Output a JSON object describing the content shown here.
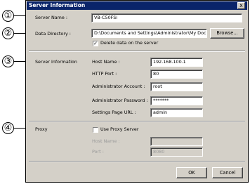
{
  "dialog": {
    "title": "Server Information",
    "close_glyph": "x"
  },
  "callouts": [
    "①",
    "②",
    "③",
    "④"
  ],
  "server": {
    "name_label": "Server Name :",
    "name_value": "VB-C50FSi",
    "dir_label": "Data Directory :",
    "dir_value": "D:\\Documents and Settings\\Administrator\\My Docume",
    "browse_label": "Browse...",
    "delete_label": "Delete data on the server",
    "delete_checked": true
  },
  "server_info": {
    "section_label": "Server Information",
    "host_label": "Host Name :",
    "host_value": "192.168.100.1",
    "port_label": "HTTP Port :",
    "port_value": "80",
    "account_label": "Administrator Account :",
    "account_value": "root",
    "password_label": "Administrator Password :",
    "password_value": "*******",
    "url_label": "Settings Page URL :",
    "url_value": "admin"
  },
  "proxy": {
    "section_label": "Proxy",
    "use_label": "Use Proxy Server",
    "use_checked": false,
    "host_label": "Host Name :",
    "host_value": "",
    "port_label": "Port :",
    "port_value": "8080"
  },
  "buttons": {
    "ok": "OK",
    "cancel": "Cancel"
  }
}
